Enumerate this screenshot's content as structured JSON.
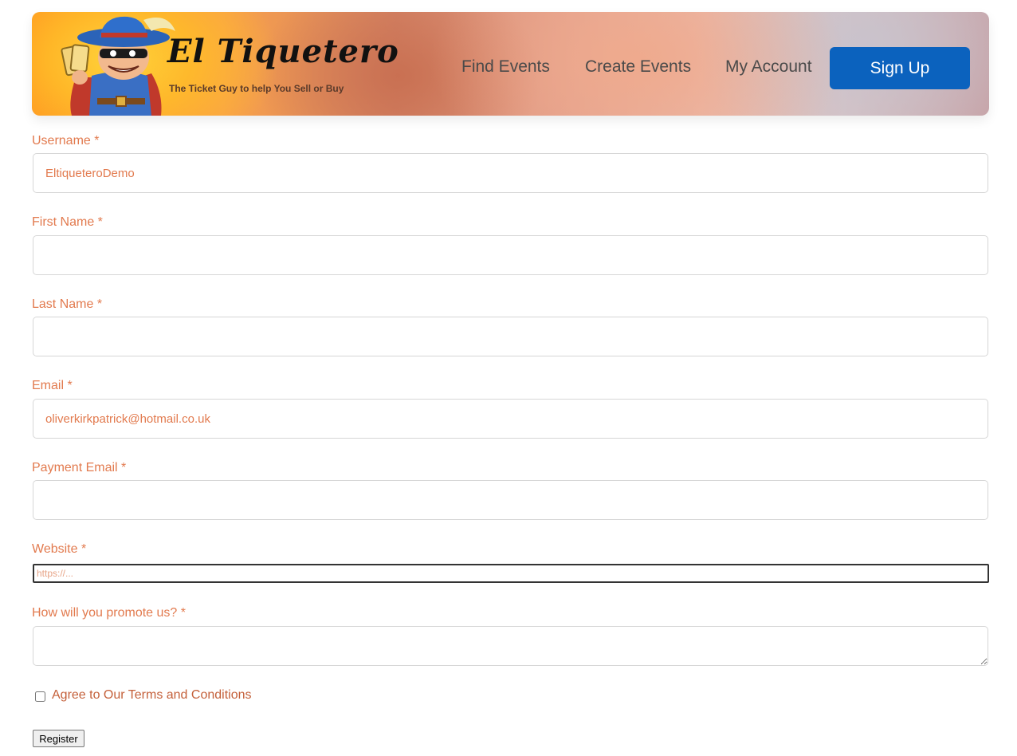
{
  "header": {
    "logo_title": "El Tiquetero",
    "logo_tagline": "The Ticket Guy to help You Sell or Buy",
    "brand_colors": {
      "signup_bg": "#0b62be",
      "label_color": "#e27a4e"
    }
  },
  "nav": {
    "find_events": "Find Events",
    "create_events": "Create Events",
    "my_account": "My Account",
    "sign_up": "Sign Up"
  },
  "form": {
    "username": {
      "label": "Username *",
      "value": "EltiqueteroDemo"
    },
    "first_name": {
      "label": "First Name *",
      "value": ""
    },
    "last_name": {
      "label": "Last Name *",
      "value": ""
    },
    "email": {
      "label": "Email *",
      "value": "oliverkirkpatrick@hotmail.co.uk"
    },
    "payment_email": {
      "label": "Payment Email *",
      "value": ""
    },
    "website": {
      "label": "Website *",
      "placeholder": "https://..."
    },
    "promote": {
      "label": "How will you promote us? *",
      "value": ""
    },
    "terms_label": "Agree to Our Terms and Conditions",
    "terms_checked": false,
    "register_label": "Register"
  },
  "icons": {
    "mascot": "bandit-mascot-icon"
  }
}
